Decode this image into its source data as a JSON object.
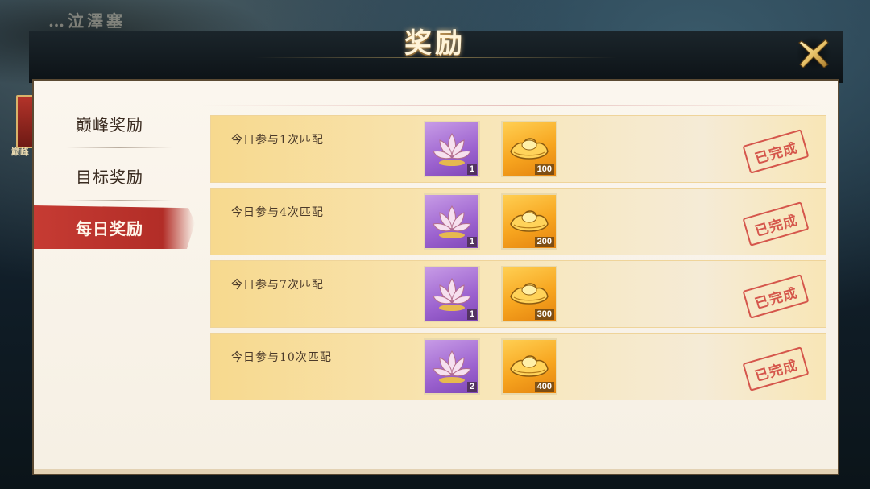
{
  "background": {
    "top_text": "…泣澤塞",
    "left_label": "巅峰"
  },
  "header": {
    "title": "奖励"
  },
  "sidebar": {
    "tabs": [
      {
        "label": "巅峰奖励",
        "active": false
      },
      {
        "label": "目标奖励",
        "active": false
      },
      {
        "label": "每日奖励",
        "active": true
      }
    ]
  },
  "rewards": [
    {
      "label": "今日参与1次匹配",
      "items": [
        {
          "icon": "lotus-icon",
          "qty": "1"
        },
        {
          "icon": "gold-ingot-icon",
          "qty": "100"
        }
      ],
      "status": "已完成"
    },
    {
      "label": "今日参与4次匹配",
      "items": [
        {
          "icon": "lotus-icon",
          "qty": "1"
        },
        {
          "icon": "gold-ingot-icon",
          "qty": "200"
        }
      ],
      "status": "已完成"
    },
    {
      "label": "今日参与7次匹配",
      "items": [
        {
          "icon": "lotus-icon",
          "qty": "1"
        },
        {
          "icon": "gold-ingot-icon",
          "qty": "300"
        }
      ],
      "status": "已完成"
    },
    {
      "label": "今日参与10次匹配",
      "items": [
        {
          "icon": "lotus-icon",
          "qty": "2"
        },
        {
          "icon": "gold-ingot-icon",
          "qty": "400"
        }
      ],
      "status": "已完成"
    }
  ],
  "colors": {
    "active_tab": "#c63b33",
    "stamp": "#d2473f",
    "row_gold": "#f7d98e",
    "item_purple": "#9c62cf",
    "item_gold": "#f7a51f"
  }
}
